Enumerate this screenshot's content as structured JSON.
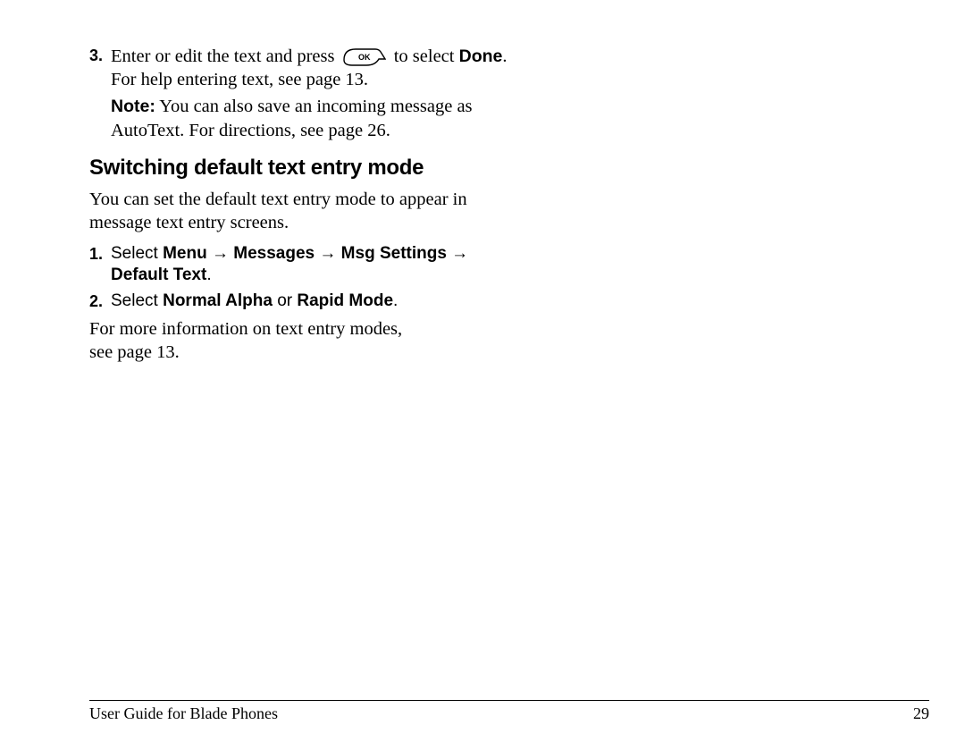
{
  "step3": {
    "marker": "3.",
    "t1": "Enter or edit the text and press ",
    "t2": " to select ",
    "done": "Done",
    "t3": ". For help entering text, see page 13."
  },
  "note": {
    "label": "Note:",
    "t1": "  You can also save an incoming message as AutoText. For directions, see page 26."
  },
  "heading": "Switching default text entry mode",
  "intro": "You can set the default text entry mode to appear in message text entry screens.",
  "s1": {
    "marker": "1.",
    "select": "Select ",
    "menu": "Menu",
    "arrow": " → ",
    "messages": "Messages",
    "msg_settings": "Msg Settings",
    "arrow_trail": " →",
    "default_text": "Default Text",
    "period": "."
  },
  "s2": {
    "marker": "2.",
    "select": "Select ",
    "normal": "Normal Alpha",
    "or": " or ",
    "rapid": "Rapid Mode",
    "period": "."
  },
  "outro1": "For more information on text entry modes,",
  "outro2": "see page 13.",
  "footer_left": "User Guide for Blade Phones",
  "footer_right": "29",
  "ok_label": "OK"
}
